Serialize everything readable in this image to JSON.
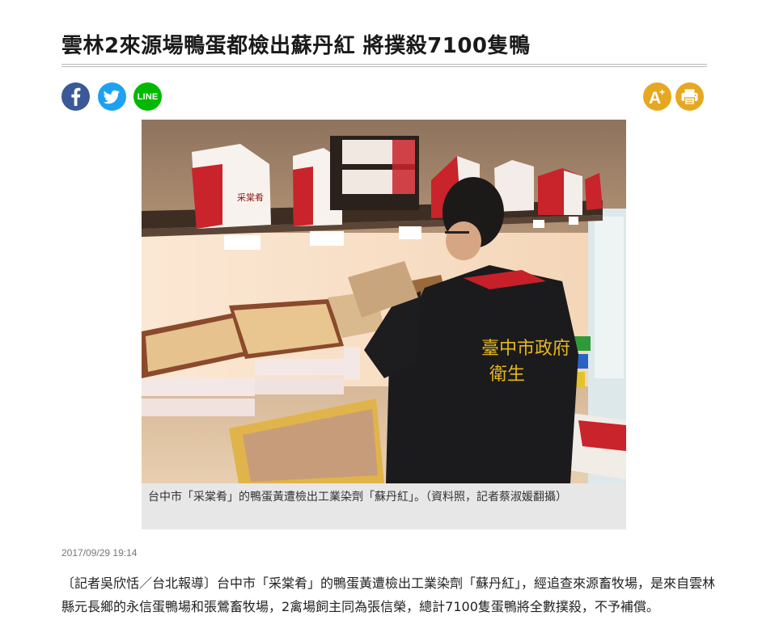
{
  "article": {
    "title": "雲林2來源場鴨蛋都檢出蘇丹紅 將撲殺7100隻鴨",
    "caption": "台中市「采棠肴」的鴨蛋黃遭檢出工業染劑「蘇丹紅」。（資料照，記者蔡淑媛翻攝）",
    "date": "2017/09/29 19:14",
    "paragraph": "〔記者吳欣恬／台北報導〕台中市「采棠肴」的鴨蛋黃遭檢出工業染劑「蘇丹紅」，經追查來源畜牧場，是來自雲林縣元長鄉的永信蛋鴨場和張鶯畜牧場，2禽場飼主同為張信榮，總計7100隻蛋鴨將全數撲殺，不予補償。"
  },
  "share": {
    "line_label": "LINE",
    "font_size_label": "A+"
  },
  "photo": {
    "box_brand": "采棠肴",
    "vest_text_line1": "臺中市政府",
    "vest_text_line2": "衛生"
  },
  "colors": {
    "facebook": "#3b5998",
    "twitter": "#1da1f2",
    "line": "#00b900",
    "tool_buttons": "#e6a820",
    "caption_bg": "#e7e7e7"
  },
  "icons": {
    "facebook": "facebook-icon",
    "twitter": "twitter-icon",
    "line": "line-icon",
    "font_size": "font-size-increase-icon",
    "print": "printer-icon"
  }
}
